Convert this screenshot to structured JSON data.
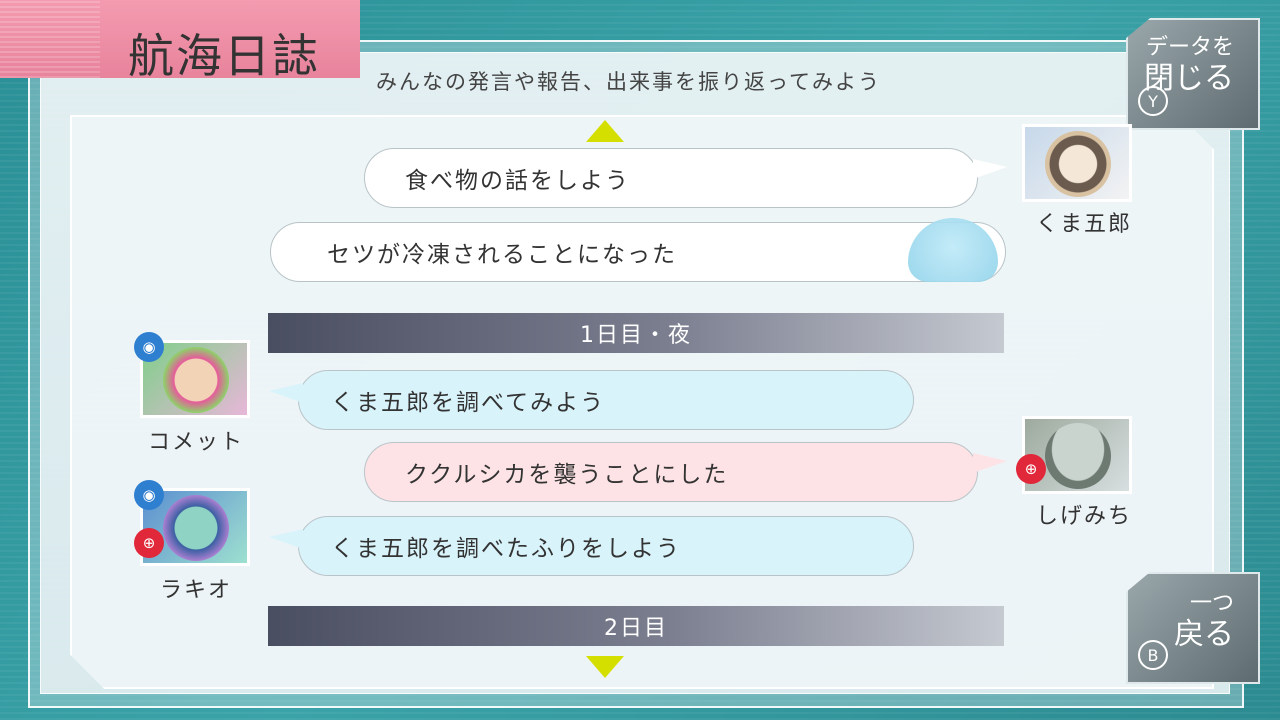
{
  "header": {
    "title": "航海日誌",
    "subtitle": "みんなの発言や報告、出来事を振り返ってみよう"
  },
  "buttons": {
    "close": {
      "line1": "データを",
      "line2": "閉じる",
      "key": "Y"
    },
    "back": {
      "line1": "一つ",
      "line2": "戻る",
      "key": "B"
    }
  },
  "log": {
    "entries": [
      {
        "text": "食べ物の話をしよう",
        "speaker": "くま五郎"
      },
      {
        "text": "セツが冷凍されることになった"
      },
      {
        "divider": "1日目・夜"
      },
      {
        "text": "くま五郎を調べてみよう",
        "speaker": "コメット"
      },
      {
        "text": "ククルシカを襲うことにした",
        "speaker": "しげみち"
      },
      {
        "text": "くま五郎を調べたふりをしよう",
        "speaker": "ラキオ"
      },
      {
        "divider": "2日目"
      }
    ]
  },
  "colors": {
    "title_tab": "#e8839c",
    "arrow": "#d4df00",
    "bubble_blue": "#d9f3fb",
    "bubble_pink": "#fde3e6",
    "role_blue": "#2f7fd1",
    "role_red": "#e0283a"
  }
}
